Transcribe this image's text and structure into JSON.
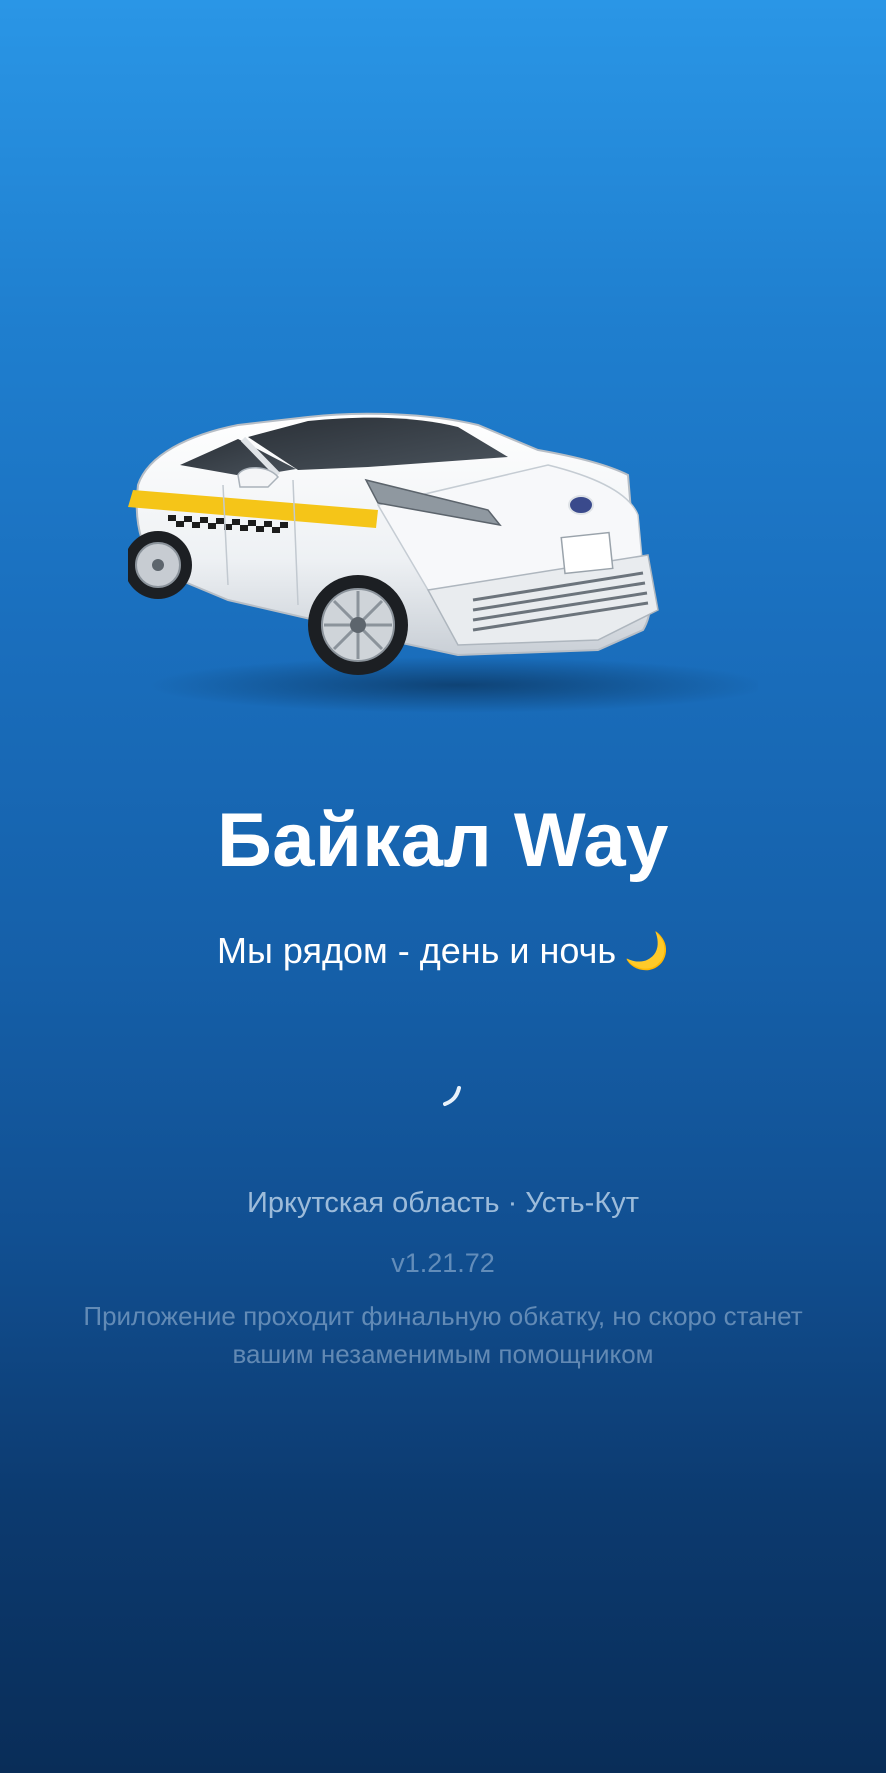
{
  "app": {
    "title": "Байкал Way",
    "tagline": "Мы рядом - день и ночь",
    "tagline_emoji": "🌙",
    "region": "Иркутская область · Усть-Кут",
    "version": "v1.21.72",
    "notice": "Приложение проходит финальную обкатку, но скоро станет вашим незаменимым помощником"
  },
  "hero": {
    "image": "white-taxi-sedan-with-yellow-stripe",
    "stripe_color": "#f5c518",
    "body_color": "#f2f4f6"
  },
  "loader": {
    "icon": "loading-spinner-icon"
  },
  "colors": {
    "background_top": "#2a96e6",
    "background_bottom": "#092d58",
    "title": "#ffffff",
    "muted_text": "#b9d2ea"
  }
}
